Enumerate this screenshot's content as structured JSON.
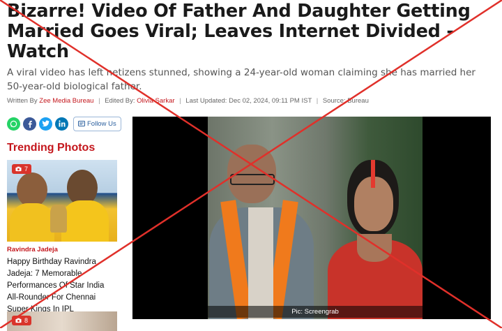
{
  "article": {
    "headline": "Bizarre! Video Of Father And Daughter Getting Married Goes Viral; Leaves Internet Divided - Watch",
    "subheadline": "A viral video has left netizens stunned, showing a 24-year-old woman claiming she has married her 50-year-old biological father.",
    "byline": {
      "written_by_label": "Written By",
      "written_by": "Zee Media Bureau",
      "edited_by_label": "Edited By:",
      "edited_by": "Olivia Sarkar",
      "updated_label": "Last Updated:",
      "updated": "Dec 02, 2024, 09:11 PM IST",
      "source_label": "Source:",
      "source": "Bureau"
    },
    "video_caption": "Pic: Screengrab"
  },
  "social": {
    "icons": [
      "whatsapp-icon",
      "facebook-icon",
      "twitter-icon",
      "linkedin-icon"
    ],
    "follow_label": "Follow Us"
  },
  "trending": {
    "title": "Trending Photos",
    "items": [
      {
        "count": "7",
        "category": "Ravindra Jadeja",
        "title": "Happy Birthday Ravindra Jadeja: 7 Memorable Performances Of Star India All-Rounder For Chennai Super Kings In IPL"
      },
      {
        "count": "8"
      }
    ]
  },
  "colors": {
    "accent_red": "#c4161c",
    "cross_red": "#e0302a"
  }
}
